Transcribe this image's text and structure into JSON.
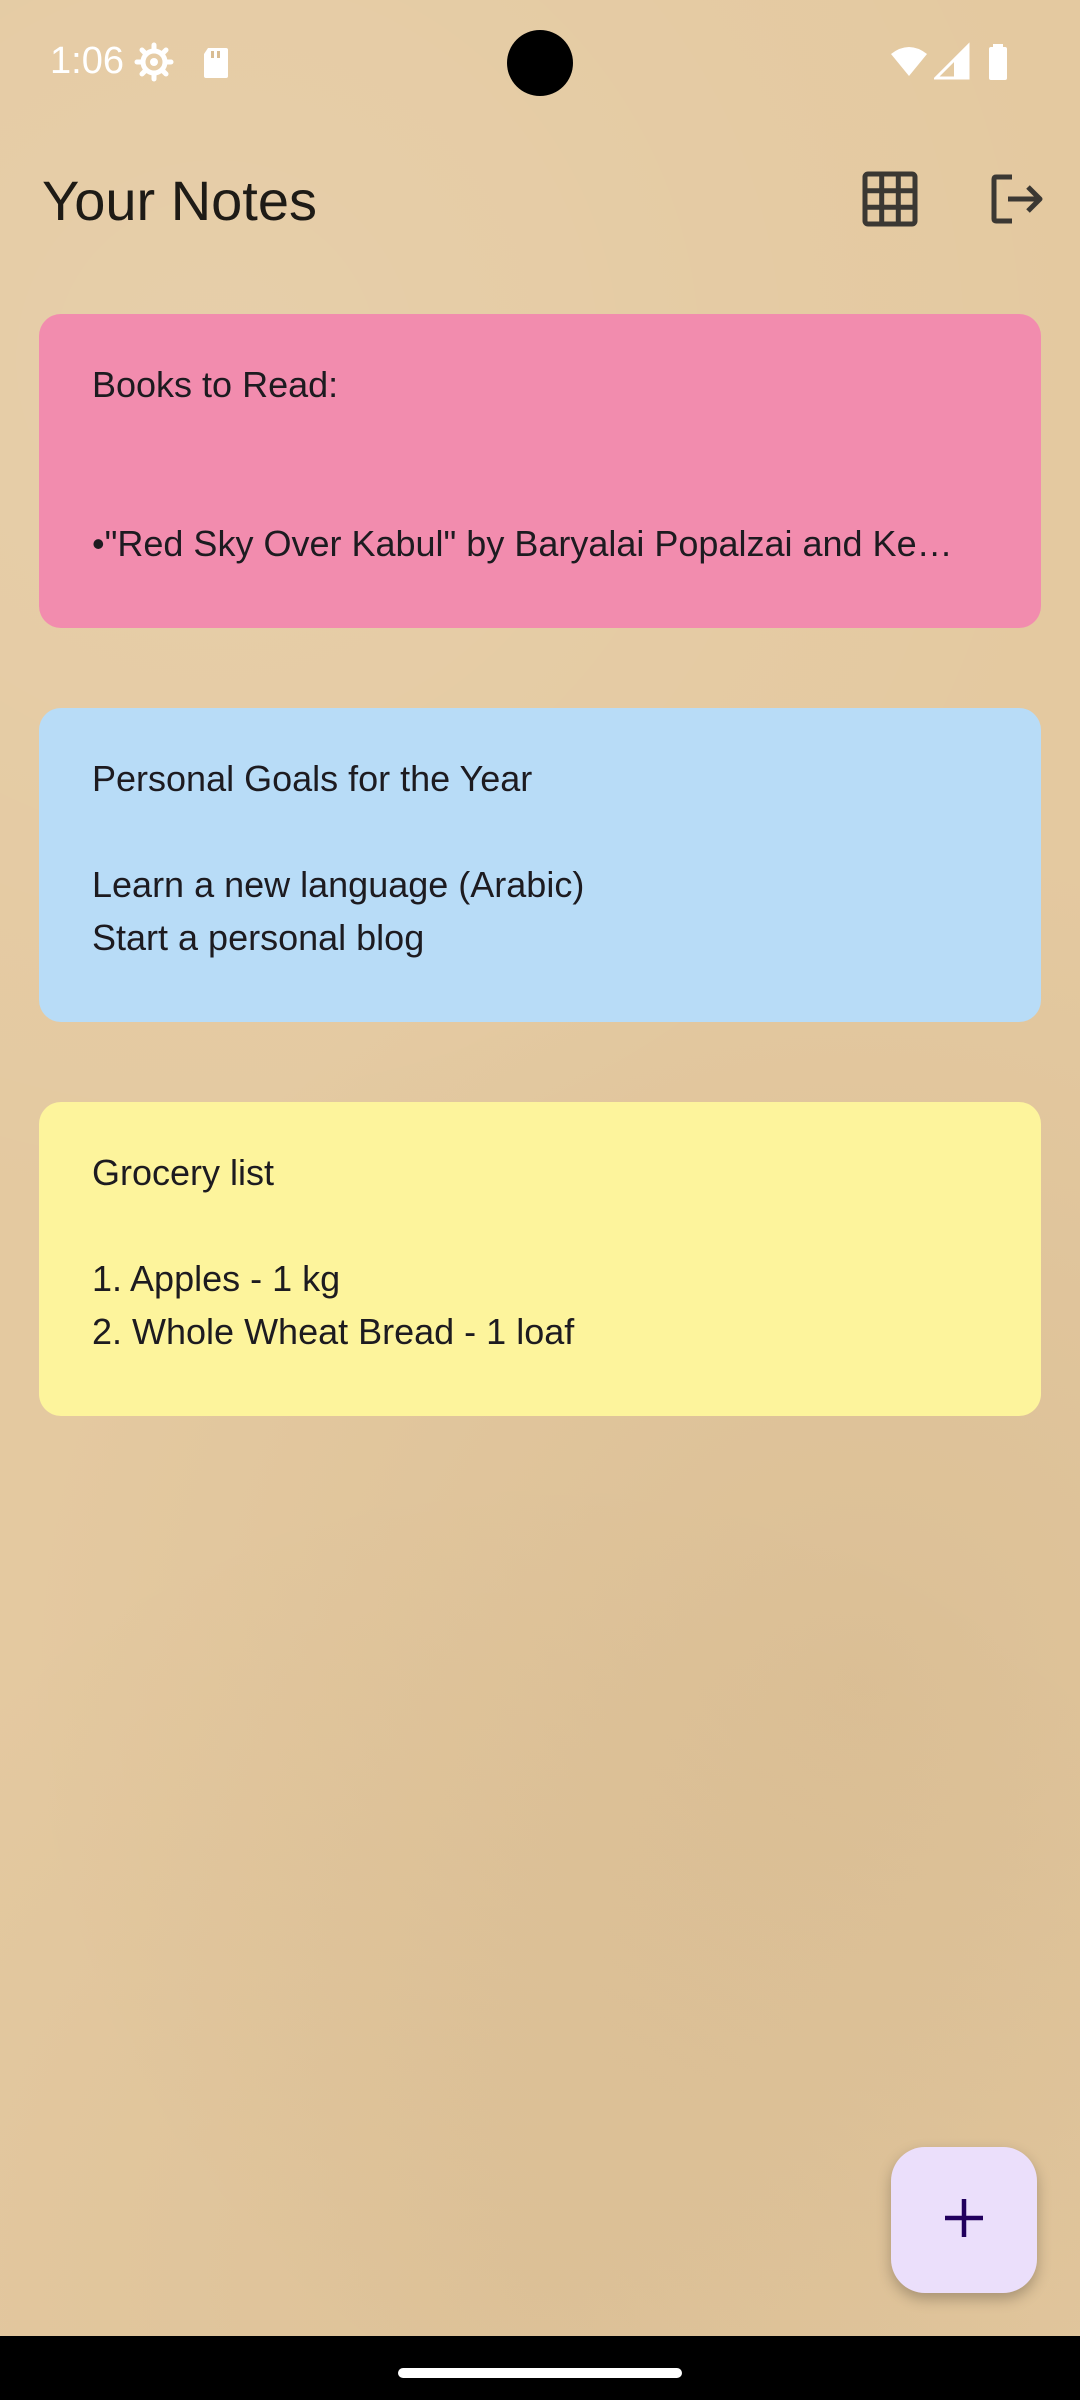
{
  "status_bar": {
    "time": "1:06",
    "icons": [
      "settings-gear-icon",
      "sd-card-icon",
      "wifi-icon",
      "cell-signal-icon",
      "battery-icon"
    ]
  },
  "header": {
    "title": "Your Notes",
    "actions": [
      "grid-view-icon",
      "logout-icon"
    ]
  },
  "notes": [
    {
      "color": "#f28cae",
      "lines": [
        "Books to Read:",
        "",
        "",
        "•\"Red Sky Over Kabul\"  by  Baryalai Popalzai and Ke…"
      ]
    },
    {
      "color": "#b8dcf7",
      "lines": [
        "Personal Goals for the Year",
        "",
        "Learn a new language (Arabic)",
        "Start a personal blog"
      ]
    },
    {
      "color": "#fdf49c",
      "lines": [
        "Grocery list",
        "",
        "1. Apples - 1 kg",
        "2. Whole Wheat Bread - 1 loaf"
      ]
    }
  ],
  "fab": {
    "icon": "plus-icon",
    "color": "#ebdffb"
  }
}
